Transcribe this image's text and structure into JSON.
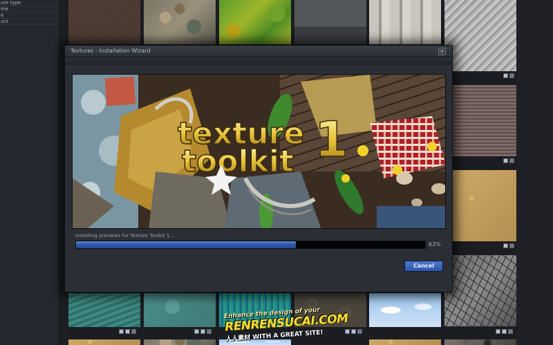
{
  "left_panel": {
    "rows": [
      "ure type",
      "me",
      "e",
      "uct"
    ]
  },
  "dialog": {
    "title": "Textures - Installation Wizard",
    "close_glyph": "✕",
    "banner_line1": "texture",
    "banner_line2": "toolkit",
    "banner_number": "1",
    "status_text": "Installing previews for Texture Toolkit 1...",
    "progress_percent": 63,
    "progress_label": "63%",
    "cancel_label": "Cancel"
  },
  "watermark": {
    "line1": "Enhance the design of your",
    "line2": "RENRENSUCAI.COM",
    "line3": "人人素材  WITH A GREAT SITE!"
  },
  "colors": {
    "accent": "#2f56a8",
    "dialog_bg": "#2b2e35",
    "app_bg": "#1b1d22"
  }
}
